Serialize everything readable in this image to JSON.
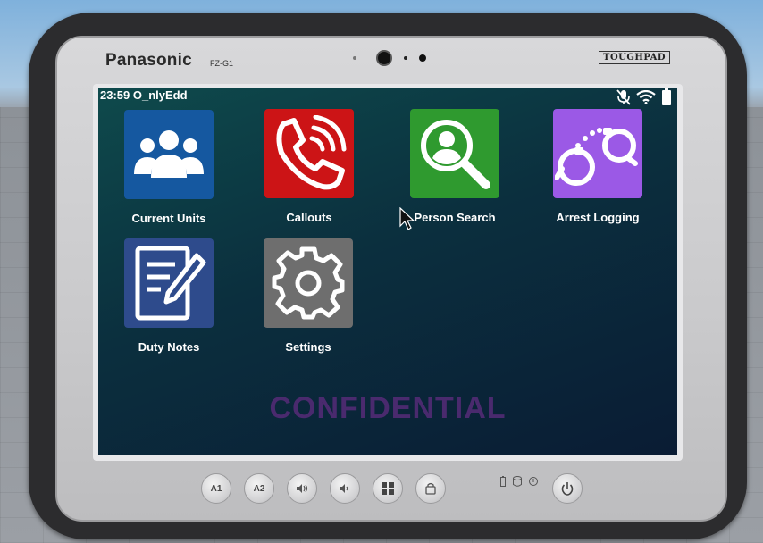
{
  "device": {
    "brand": "Panasonic",
    "model": "FZ-G1",
    "badge": "TOUGHPAD"
  },
  "status_bar": {
    "time_user": "23:59 O_nlyEdd",
    "icons": [
      "mic-muted-icon",
      "wifi-icon",
      "battery-icon"
    ]
  },
  "apps": [
    {
      "label": "Current Units",
      "icon": "users-icon",
      "color": "#1558a0"
    },
    {
      "label": "Callouts",
      "icon": "phone-ringing-icon",
      "color": "#cc1416"
    },
    {
      "label": "Person Search",
      "icon": "person-search-icon",
      "color": "#2f9a2f"
    },
    {
      "label": "Arrest Logging",
      "icon": "handcuffs-icon",
      "color": "#9b59e6"
    },
    {
      "label": "Duty Notes",
      "icon": "notes-pencil-icon",
      "color": "#2e4b8c"
    },
    {
      "label": "Settings",
      "icon": "gear-icon",
      "color": "#6e6e6e"
    }
  ],
  "watermark": "CONFIDENTIAL",
  "hardware_buttons": {
    "a1": "A1",
    "a2": "A2"
  }
}
